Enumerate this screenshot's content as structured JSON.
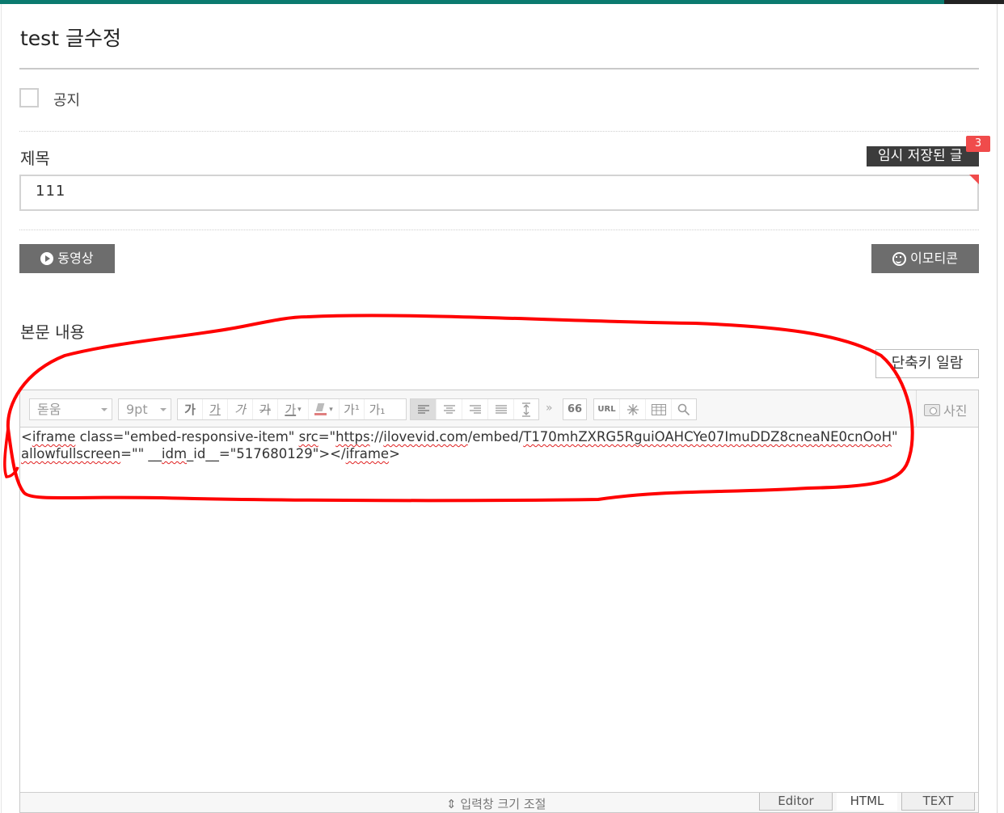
{
  "page": {
    "title": "test 글수정",
    "accent_color": "#0b7a6f"
  },
  "notice": {
    "label": "공지",
    "checked": false
  },
  "subject": {
    "label": "제목",
    "value": "111",
    "drafts_button": "임시 저장된 글",
    "drafts_count": "3"
  },
  "media": {
    "video_button": "동영상",
    "emoticon_button": "이모티콘"
  },
  "body": {
    "label": "본문 내용",
    "shortcut_button": "단축키 일람"
  },
  "toolbar": {
    "font_family": "돋움",
    "font_size": "9pt",
    "text_style_buttons": [
      "가",
      "가",
      "가",
      "가",
      "가"
    ],
    "superscript": "가¹",
    "subscript": "가₁",
    "more": "»",
    "quote": "66",
    "url": "URL",
    "photo_button": "사진"
  },
  "content": {
    "line1_parts": [
      "<",
      "iframe",
      " class=\"embed-responsive-item\" ",
      "src",
      "=\"",
      "https",
      "://",
      "ilovevid.com",
      "/embed/",
      "T170mhZXRG5RguiOAHCYe07ImuDDZ8cneaNE0cnOoH",
      "\""
    ],
    "line2_parts": [
      "allowfullscreen",
      "=\"\" __",
      "idm",
      "_id__=\"517680129\"></",
      "iframe",
      ">"
    ]
  },
  "footer": {
    "resize_label": "⇕ 입력창 크기 조절",
    "tabs": [
      "Editor",
      "HTML",
      "TEXT"
    ],
    "active_tab": "HTML"
  },
  "annotation_color": "#ff0000"
}
